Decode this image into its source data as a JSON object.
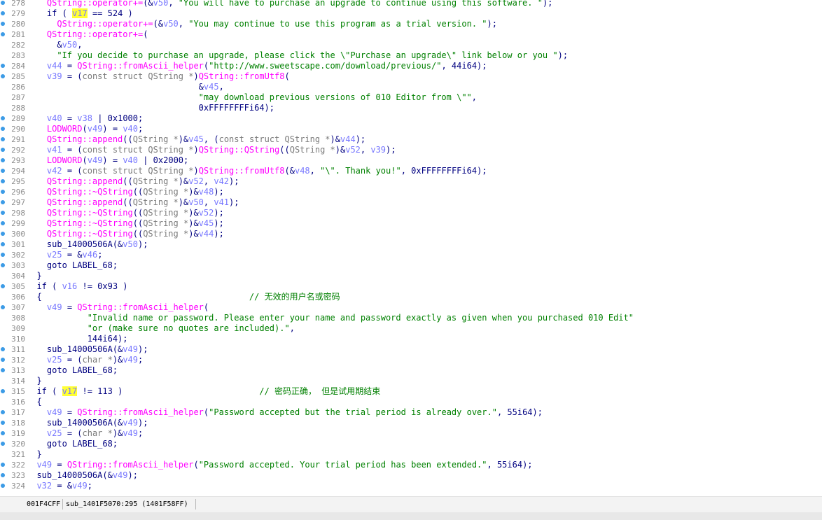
{
  "lines": [
    {
      "n": "278",
      "bp": true,
      "parts": [
        [
          "    ",
          ""
        ],
        [
          "QString::operator+=",
          "fn"
        ],
        [
          "(&",
          ""
        ],
        [
          "v50",
          "vr"
        ],
        [
          ", ",
          ""
        ],
        [
          "\"You will have to purchase an upgrade to continue using this software. \"",
          "st"
        ],
        [
          ");",
          ""
        ]
      ]
    },
    {
      "n": "279",
      "bp": true,
      "parts": [
        [
          "    if ( ",
          ""
        ],
        [
          "v17",
          "vr hl"
        ],
        [
          " == 524 )",
          ""
        ]
      ]
    },
    {
      "n": "280",
      "bp": true,
      "parts": [
        [
          "      ",
          ""
        ],
        [
          "QString::operator+=",
          "fn"
        ],
        [
          "(&",
          ""
        ],
        [
          "v50",
          "vr"
        ],
        [
          ", ",
          ""
        ],
        [
          "\"You may continue to use this program as a trial version. \"",
          "st"
        ],
        [
          ");",
          ""
        ]
      ]
    },
    {
      "n": "281",
      "bp": true,
      "parts": [
        [
          "    ",
          ""
        ],
        [
          "QString::operator+=",
          "fn"
        ],
        [
          "(",
          ""
        ]
      ]
    },
    {
      "n": "282",
      "bp": false,
      "parts": [
        [
          "      &",
          ""
        ],
        [
          "v50",
          "vr"
        ],
        [
          ",",
          ""
        ]
      ]
    },
    {
      "n": "283",
      "bp": false,
      "parts": [
        [
          "      ",
          ""
        ],
        [
          "\"If you decide to purchase an upgrade, please click the \\\"Purchase an upgrade\\\" link below or you \"",
          "st"
        ],
        [
          ");",
          ""
        ]
      ]
    },
    {
      "n": "284",
      "bp": true,
      "parts": [
        [
          "    ",
          ""
        ],
        [
          "v44",
          "vr"
        ],
        [
          " = ",
          ""
        ],
        [
          "QString::fromAscii_helper",
          "fn"
        ],
        [
          "(",
          ""
        ],
        [
          "\"http://www.sweetscape.com/download/previous/\"",
          "st"
        ],
        [
          ", 44i64);",
          ""
        ]
      ]
    },
    {
      "n": "285",
      "bp": true,
      "parts": [
        [
          "    ",
          ""
        ],
        [
          "v39",
          "vr"
        ],
        [
          " = (",
          ""
        ],
        [
          "const struct QString *",
          "ty"
        ],
        [
          ")",
          ""
        ],
        [
          "QString::fromUtf8",
          "fn"
        ],
        [
          "(",
          ""
        ]
      ]
    },
    {
      "n": "286",
      "bp": false,
      "parts": [
        [
          "                                  &",
          ""
        ],
        [
          "v45",
          "vr"
        ],
        [
          ",",
          ""
        ]
      ]
    },
    {
      "n": "287",
      "bp": false,
      "parts": [
        [
          "                                  ",
          ""
        ],
        [
          "\"may download previous versions of 010 Editor from \\\"\"",
          "st"
        ],
        [
          ",",
          ""
        ]
      ]
    },
    {
      "n": "288",
      "bp": false,
      "parts": [
        [
          "                                  0xFFFFFFFFi64);",
          ""
        ]
      ]
    },
    {
      "n": "289",
      "bp": true,
      "parts": [
        [
          "    ",
          ""
        ],
        [
          "v40",
          "vr"
        ],
        [
          " = ",
          ""
        ],
        [
          "v38",
          "vr"
        ],
        [
          " | 0x1000;",
          ""
        ]
      ]
    },
    {
      "n": "290",
      "bp": true,
      "parts": [
        [
          "    ",
          ""
        ],
        [
          "LODWORD",
          "fn"
        ],
        [
          "(",
          ""
        ],
        [
          "v49",
          "vr"
        ],
        [
          ") = ",
          ""
        ],
        [
          "v40",
          "vr"
        ],
        [
          ";",
          ""
        ]
      ]
    },
    {
      "n": "291",
      "bp": true,
      "parts": [
        [
          "    ",
          ""
        ],
        [
          "QString::append",
          "fn"
        ],
        [
          "((",
          ""
        ],
        [
          "QString *",
          "ty"
        ],
        [
          ")&",
          ""
        ],
        [
          "v45",
          "vr"
        ],
        [
          ", (",
          ""
        ],
        [
          "const struct QString *",
          "ty"
        ],
        [
          ")&",
          ""
        ],
        [
          "v44",
          "vr"
        ],
        [
          ");",
          ""
        ]
      ]
    },
    {
      "n": "292",
      "bp": true,
      "parts": [
        [
          "    ",
          ""
        ],
        [
          "v41",
          "vr"
        ],
        [
          " = (",
          ""
        ],
        [
          "const struct QString *",
          "ty"
        ],
        [
          ")",
          ""
        ],
        [
          "QString::QString",
          "fn"
        ],
        [
          "((",
          ""
        ],
        [
          "QString *",
          "ty"
        ],
        [
          ")&",
          ""
        ],
        [
          "v52",
          "vr"
        ],
        [
          ", ",
          ""
        ],
        [
          "v39",
          "vr"
        ],
        [
          ");",
          ""
        ]
      ]
    },
    {
      "n": "293",
      "bp": true,
      "parts": [
        [
          "    ",
          ""
        ],
        [
          "LODWORD",
          "fn"
        ],
        [
          "(",
          ""
        ],
        [
          "v49",
          "vr"
        ],
        [
          ") = ",
          ""
        ],
        [
          "v40",
          "vr"
        ],
        [
          " | 0x2000;",
          ""
        ]
      ]
    },
    {
      "n": "294",
      "bp": true,
      "parts": [
        [
          "    ",
          ""
        ],
        [
          "v42",
          "vr"
        ],
        [
          " = (",
          ""
        ],
        [
          "const struct QString *",
          "ty"
        ],
        [
          ")",
          ""
        ],
        [
          "QString::fromUtf8",
          "fn"
        ],
        [
          "(&",
          ""
        ],
        [
          "v48",
          "vr"
        ],
        [
          ", ",
          ""
        ],
        [
          "\"\\\". Thank you!\"",
          "st"
        ],
        [
          ", 0xFFFFFFFFi64);",
          ""
        ]
      ]
    },
    {
      "n": "295",
      "bp": true,
      "parts": [
        [
          "    ",
          ""
        ],
        [
          "QString::append",
          "fn"
        ],
        [
          "((",
          ""
        ],
        [
          "QString *",
          "ty"
        ],
        [
          ")&",
          ""
        ],
        [
          "v52",
          "vr"
        ],
        [
          ", ",
          ""
        ],
        [
          "v42",
          "vr"
        ],
        [
          ");",
          ""
        ]
      ]
    },
    {
      "n": "296",
      "bp": true,
      "parts": [
        [
          "    ",
          ""
        ],
        [
          "QString::~QString",
          "fn"
        ],
        [
          "((",
          ""
        ],
        [
          "QString *",
          "ty"
        ],
        [
          ")&",
          ""
        ],
        [
          "v48",
          "vr"
        ],
        [
          ");",
          ""
        ]
      ]
    },
    {
      "n": "297",
      "bp": true,
      "parts": [
        [
          "    ",
          ""
        ],
        [
          "QString::append",
          "fn"
        ],
        [
          "((",
          ""
        ],
        [
          "QString *",
          "ty"
        ],
        [
          ")&",
          ""
        ],
        [
          "v50",
          "vr"
        ],
        [
          ", ",
          ""
        ],
        [
          "v41",
          "vr"
        ],
        [
          ");",
          ""
        ]
      ]
    },
    {
      "n": "298",
      "bp": true,
      "parts": [
        [
          "    ",
          ""
        ],
        [
          "QString::~QString",
          "fn"
        ],
        [
          "((",
          ""
        ],
        [
          "QString *",
          "ty"
        ],
        [
          ")&",
          ""
        ],
        [
          "v52",
          "vr"
        ],
        [
          ");",
          ""
        ]
      ]
    },
    {
      "n": "299",
      "bp": true,
      "parts": [
        [
          "    ",
          ""
        ],
        [
          "QString::~QString",
          "fn"
        ],
        [
          "((",
          ""
        ],
        [
          "QString *",
          "ty"
        ],
        [
          ")&",
          ""
        ],
        [
          "v45",
          "vr"
        ],
        [
          ");",
          ""
        ]
      ]
    },
    {
      "n": "300",
      "bp": true,
      "parts": [
        [
          "    ",
          ""
        ],
        [
          "QString::~QString",
          "fn"
        ],
        [
          "((",
          ""
        ],
        [
          "QString *",
          "ty"
        ],
        [
          ")&",
          ""
        ],
        [
          "v44",
          "vr"
        ],
        [
          ");",
          ""
        ]
      ]
    },
    {
      "n": "301",
      "bp": true,
      "parts": [
        [
          "    sub_14000506A(&",
          ""
        ],
        [
          "v50",
          "vr"
        ],
        [
          ");",
          ""
        ]
      ]
    },
    {
      "n": "302",
      "bp": true,
      "parts": [
        [
          "    ",
          ""
        ],
        [
          "v25",
          "vr"
        ],
        [
          " = &",
          ""
        ],
        [
          "v46",
          "vr"
        ],
        [
          ";",
          ""
        ]
      ]
    },
    {
      "n": "303",
      "bp": true,
      "parts": [
        [
          "    goto LABEL_68;",
          ""
        ]
      ]
    },
    {
      "n": "304",
      "bp": false,
      "parts": [
        [
          "  }",
          ""
        ]
      ]
    },
    {
      "n": "305",
      "bp": true,
      "parts": [
        [
          "  if ( ",
          ""
        ],
        [
          "v16",
          "vr"
        ],
        [
          " != 0x93 )",
          ""
        ]
      ]
    },
    {
      "n": "306",
      "bp": false,
      "parts": [
        [
          "  {                                         ",
          ""
        ],
        [
          "// 无效的用户名或密码",
          "cm"
        ]
      ]
    },
    {
      "n": "307",
      "bp": true,
      "parts": [
        [
          "    ",
          ""
        ],
        [
          "v49",
          "vr"
        ],
        [
          " = ",
          ""
        ],
        [
          "QString::fromAscii_helper",
          "fn"
        ],
        [
          "(",
          ""
        ]
      ]
    },
    {
      "n": "308",
      "bp": false,
      "parts": [
        [
          "            ",
          ""
        ],
        [
          "\"Invalid name or password. Please enter your name and password exactly as given when you purchased 010 Edit\"",
          "st"
        ]
      ]
    },
    {
      "n": "309",
      "bp": false,
      "parts": [
        [
          "            ",
          ""
        ],
        [
          "\"or (make sure no quotes are included).\"",
          "st"
        ],
        [
          ",",
          ""
        ]
      ]
    },
    {
      "n": "310",
      "bp": false,
      "parts": [
        [
          "            144i64);",
          ""
        ]
      ]
    },
    {
      "n": "311",
      "bp": true,
      "parts": [
        [
          "    sub_14000506A(&",
          ""
        ],
        [
          "v49",
          "vr"
        ],
        [
          ");",
          ""
        ]
      ]
    },
    {
      "n": "312",
      "bp": true,
      "parts": [
        [
          "    ",
          ""
        ],
        [
          "v25",
          "vr"
        ],
        [
          " = (",
          ""
        ],
        [
          "char *",
          "ty"
        ],
        [
          ")&",
          ""
        ],
        [
          "v49",
          "vr"
        ],
        [
          ";",
          ""
        ]
      ]
    },
    {
      "n": "313",
      "bp": true,
      "parts": [
        [
          "    goto LABEL_68;",
          ""
        ]
      ]
    },
    {
      "n": "314",
      "bp": false,
      "parts": [
        [
          "  }",
          ""
        ]
      ]
    },
    {
      "n": "315",
      "bp": true,
      "parts": [
        [
          "  if ( ",
          ""
        ],
        [
          "v17",
          "vr hl"
        ],
        [
          " != 113 )                           ",
          ""
        ],
        [
          "// 密码正确， 但是试用期结束",
          "cm"
        ]
      ]
    },
    {
      "n": "316",
      "bp": false,
      "parts": [
        [
          "  {",
          ""
        ]
      ]
    },
    {
      "n": "317",
      "bp": true,
      "parts": [
        [
          "    ",
          ""
        ],
        [
          "v49",
          "vr"
        ],
        [
          " = ",
          ""
        ],
        [
          "QString::fromAscii_helper",
          "fn"
        ],
        [
          "(",
          ""
        ],
        [
          "\"Password accepted but the trial period is already over.\"",
          "st"
        ],
        [
          ", 55i64);",
          ""
        ]
      ]
    },
    {
      "n": "318",
      "bp": true,
      "parts": [
        [
          "    sub_14000506A(&",
          ""
        ],
        [
          "v49",
          "vr"
        ],
        [
          ");",
          ""
        ]
      ]
    },
    {
      "n": "319",
      "bp": true,
      "parts": [
        [
          "    ",
          ""
        ],
        [
          "v25",
          "vr"
        ],
        [
          " = (",
          ""
        ],
        [
          "char *",
          "ty"
        ],
        [
          ")&",
          ""
        ],
        [
          "v49",
          "vr"
        ],
        [
          ";",
          ""
        ]
      ]
    },
    {
      "n": "320",
      "bp": true,
      "parts": [
        [
          "    goto LABEL_68;",
          ""
        ]
      ]
    },
    {
      "n": "321",
      "bp": false,
      "parts": [
        [
          "  }",
          ""
        ]
      ]
    },
    {
      "n": "322",
      "bp": true,
      "parts": [
        [
          "  ",
          ""
        ],
        [
          "v49",
          "vr"
        ],
        [
          " = ",
          ""
        ],
        [
          "QString::fromAscii_helper",
          "fn"
        ],
        [
          "(",
          ""
        ],
        [
          "\"Password accepted. Your trial period has been extended.\"",
          "st"
        ],
        [
          ", 55i64);",
          ""
        ]
      ]
    },
    {
      "n": "323",
      "bp": true,
      "parts": [
        [
          "  sub_14000506A(&",
          ""
        ],
        [
          "v49",
          "vr"
        ],
        [
          ");",
          ""
        ]
      ]
    },
    {
      "n": "324",
      "bp": true,
      "parts": [
        [
          "  ",
          ""
        ],
        [
          "v32",
          "vr"
        ],
        [
          " = &",
          ""
        ],
        [
          "v49",
          "vr"
        ],
        [
          ";",
          ""
        ]
      ]
    }
  ],
  "statusbar": {
    "address": "001F4CFF",
    "location": "sub_1401F5070:295 (1401F58FF)"
  },
  "colors": {
    "function": "#ff00ff",
    "variable": "#7777ff",
    "string": "#008000",
    "plain": "#000080",
    "highlight": "#ffff33",
    "breakpoint": "#3c9be6"
  },
  "icons": {
    "gutter_marker": "breakpoint-dot-icon"
  }
}
